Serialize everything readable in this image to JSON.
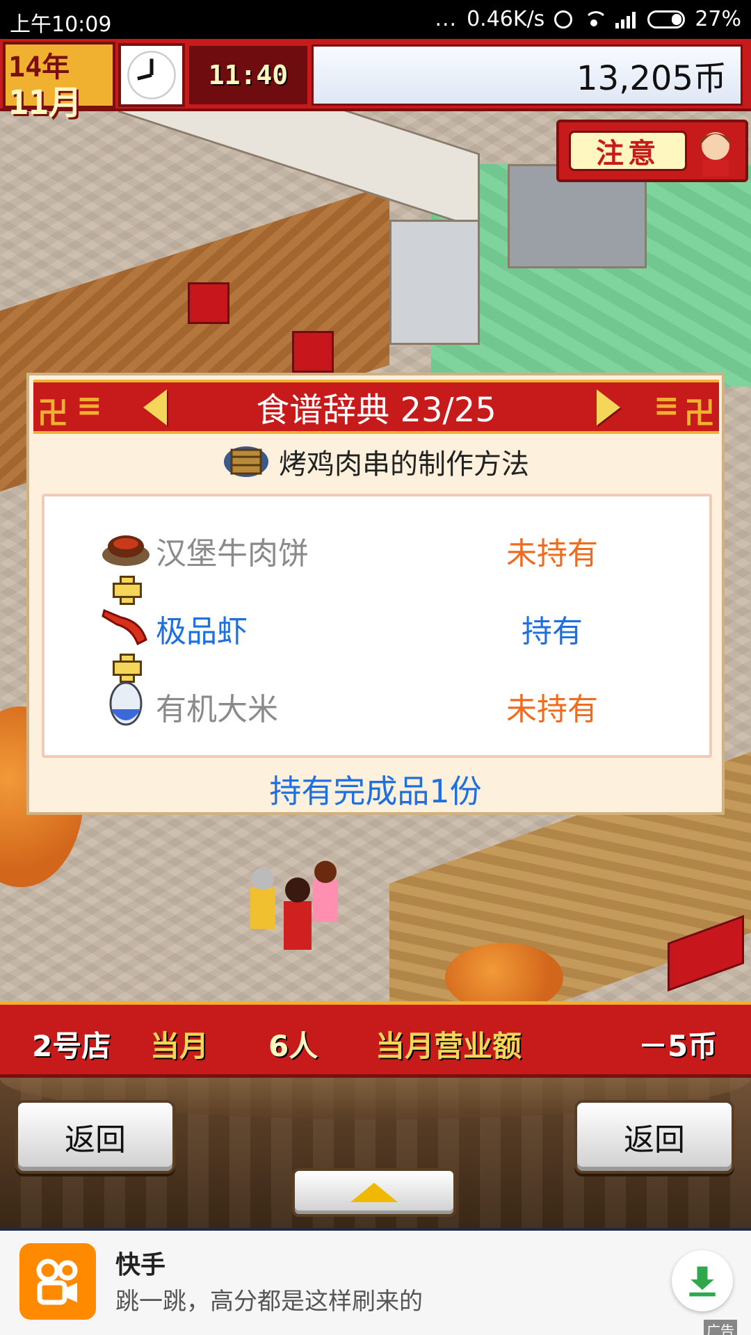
{
  "status_bar": {
    "time": "上午10:09",
    "dots": "...",
    "speed": "0.46K/s",
    "battery": "27%"
  },
  "hud": {
    "year_label": "14年",
    "month_label": "11月",
    "game_time": "11:40",
    "money": "13,205币"
  },
  "notice": {
    "label": "注意"
  },
  "dialog": {
    "title": "食谱辞典 23/25",
    "subtitle": "烤鸡肉串的制作方法",
    "ingredients": [
      {
        "name": "汉堡牛肉饼",
        "status": "未持有"
      },
      {
        "name": "极品虾",
        "status": "持有"
      },
      {
        "name": "有机大米",
        "status": "未持有"
      }
    ],
    "footer": "持有完成品1份",
    "colors": {
      "owned": "#1e6fe0",
      "not_owned": "#f26a1b",
      "unavailable_name": "#8a8a8a"
    }
  },
  "store_bar": {
    "store": "2号店",
    "month": "当月",
    "visitors": "6人",
    "revenue_label": "当月营业额",
    "revenue_value": "－5币"
  },
  "controls": {
    "left_button": "返回",
    "right_button": "返回"
  },
  "ad": {
    "title": "快手",
    "description": "跳一跳，高分都是这样刷来的",
    "tag": "广告"
  }
}
